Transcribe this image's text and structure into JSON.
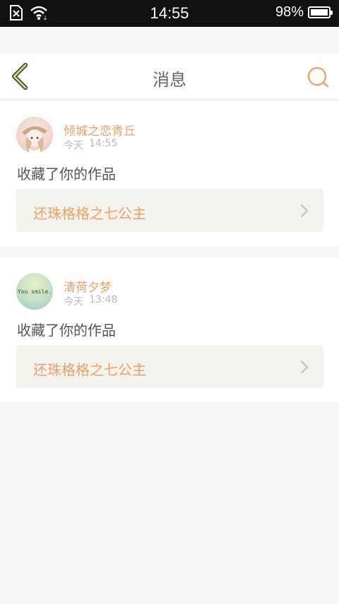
{
  "status_bar": {
    "time": "14:55",
    "battery": "98%",
    "battery_level": 0.98
  },
  "header": {
    "title": "消息"
  },
  "colors": {
    "accent": "#e9a26a",
    "back_arrow": "#c9c46a",
    "card_bg": "#f3f2ec"
  },
  "messages": [
    {
      "username": "倾城之恋青丘",
      "day": "今天",
      "time": "14:55",
      "action": "收藏了你的作品",
      "work_title": "还珠格格之七公主",
      "avatar_icon": "anime-girl-avatar"
    },
    {
      "username": "清荷夕梦",
      "day": "今天",
      "time": "13:48",
      "action": "收藏了你的作品",
      "work_title": "还珠格格之七公主",
      "avatar_icon": "you-smile-avatar",
      "avatar_text": "You smile."
    }
  ]
}
